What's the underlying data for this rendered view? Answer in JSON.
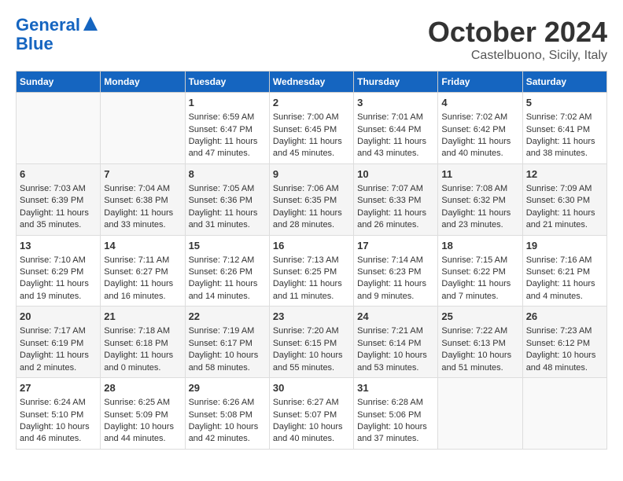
{
  "header": {
    "logo_line1": "General",
    "logo_line2": "Blue",
    "title": "October 2024",
    "location": "Castelbuono, Sicily, Italy"
  },
  "weekdays": [
    "Sunday",
    "Monday",
    "Tuesday",
    "Wednesday",
    "Thursday",
    "Friday",
    "Saturday"
  ],
  "weeks": [
    [
      {
        "day": "",
        "content": ""
      },
      {
        "day": "",
        "content": ""
      },
      {
        "day": "1",
        "content": "Sunrise: 6:59 AM\nSunset: 6:47 PM\nDaylight: 11 hours and 47 minutes."
      },
      {
        "day": "2",
        "content": "Sunrise: 7:00 AM\nSunset: 6:45 PM\nDaylight: 11 hours and 45 minutes."
      },
      {
        "day": "3",
        "content": "Sunrise: 7:01 AM\nSunset: 6:44 PM\nDaylight: 11 hours and 43 minutes."
      },
      {
        "day": "4",
        "content": "Sunrise: 7:02 AM\nSunset: 6:42 PM\nDaylight: 11 hours and 40 minutes."
      },
      {
        "day": "5",
        "content": "Sunrise: 7:02 AM\nSunset: 6:41 PM\nDaylight: 11 hours and 38 minutes."
      }
    ],
    [
      {
        "day": "6",
        "content": "Sunrise: 7:03 AM\nSunset: 6:39 PM\nDaylight: 11 hours and 35 minutes."
      },
      {
        "day": "7",
        "content": "Sunrise: 7:04 AM\nSunset: 6:38 PM\nDaylight: 11 hours and 33 minutes."
      },
      {
        "day": "8",
        "content": "Sunrise: 7:05 AM\nSunset: 6:36 PM\nDaylight: 11 hours and 31 minutes."
      },
      {
        "day": "9",
        "content": "Sunrise: 7:06 AM\nSunset: 6:35 PM\nDaylight: 11 hours and 28 minutes."
      },
      {
        "day": "10",
        "content": "Sunrise: 7:07 AM\nSunset: 6:33 PM\nDaylight: 11 hours and 26 minutes."
      },
      {
        "day": "11",
        "content": "Sunrise: 7:08 AM\nSunset: 6:32 PM\nDaylight: 11 hours and 23 minutes."
      },
      {
        "day": "12",
        "content": "Sunrise: 7:09 AM\nSunset: 6:30 PM\nDaylight: 11 hours and 21 minutes."
      }
    ],
    [
      {
        "day": "13",
        "content": "Sunrise: 7:10 AM\nSunset: 6:29 PM\nDaylight: 11 hours and 19 minutes."
      },
      {
        "day": "14",
        "content": "Sunrise: 7:11 AM\nSunset: 6:27 PM\nDaylight: 11 hours and 16 minutes."
      },
      {
        "day": "15",
        "content": "Sunrise: 7:12 AM\nSunset: 6:26 PM\nDaylight: 11 hours and 14 minutes."
      },
      {
        "day": "16",
        "content": "Sunrise: 7:13 AM\nSunset: 6:25 PM\nDaylight: 11 hours and 11 minutes."
      },
      {
        "day": "17",
        "content": "Sunrise: 7:14 AM\nSunset: 6:23 PM\nDaylight: 11 hours and 9 minutes."
      },
      {
        "day": "18",
        "content": "Sunrise: 7:15 AM\nSunset: 6:22 PM\nDaylight: 11 hours and 7 minutes."
      },
      {
        "day": "19",
        "content": "Sunrise: 7:16 AM\nSunset: 6:21 PM\nDaylight: 11 hours and 4 minutes."
      }
    ],
    [
      {
        "day": "20",
        "content": "Sunrise: 7:17 AM\nSunset: 6:19 PM\nDaylight: 11 hours and 2 minutes."
      },
      {
        "day": "21",
        "content": "Sunrise: 7:18 AM\nSunset: 6:18 PM\nDaylight: 11 hours and 0 minutes."
      },
      {
        "day": "22",
        "content": "Sunrise: 7:19 AM\nSunset: 6:17 PM\nDaylight: 10 hours and 58 minutes."
      },
      {
        "day": "23",
        "content": "Sunrise: 7:20 AM\nSunset: 6:15 PM\nDaylight: 10 hours and 55 minutes."
      },
      {
        "day": "24",
        "content": "Sunrise: 7:21 AM\nSunset: 6:14 PM\nDaylight: 10 hours and 53 minutes."
      },
      {
        "day": "25",
        "content": "Sunrise: 7:22 AM\nSunset: 6:13 PM\nDaylight: 10 hours and 51 minutes."
      },
      {
        "day": "26",
        "content": "Sunrise: 7:23 AM\nSunset: 6:12 PM\nDaylight: 10 hours and 48 minutes."
      }
    ],
    [
      {
        "day": "27",
        "content": "Sunrise: 6:24 AM\nSunset: 5:10 PM\nDaylight: 10 hours and 46 minutes."
      },
      {
        "day": "28",
        "content": "Sunrise: 6:25 AM\nSunset: 5:09 PM\nDaylight: 10 hours and 44 minutes."
      },
      {
        "day": "29",
        "content": "Sunrise: 6:26 AM\nSunset: 5:08 PM\nDaylight: 10 hours and 42 minutes."
      },
      {
        "day": "30",
        "content": "Sunrise: 6:27 AM\nSunset: 5:07 PM\nDaylight: 10 hours and 40 minutes."
      },
      {
        "day": "31",
        "content": "Sunrise: 6:28 AM\nSunset: 5:06 PM\nDaylight: 10 hours and 37 minutes."
      },
      {
        "day": "",
        "content": ""
      },
      {
        "day": "",
        "content": ""
      }
    ]
  ]
}
